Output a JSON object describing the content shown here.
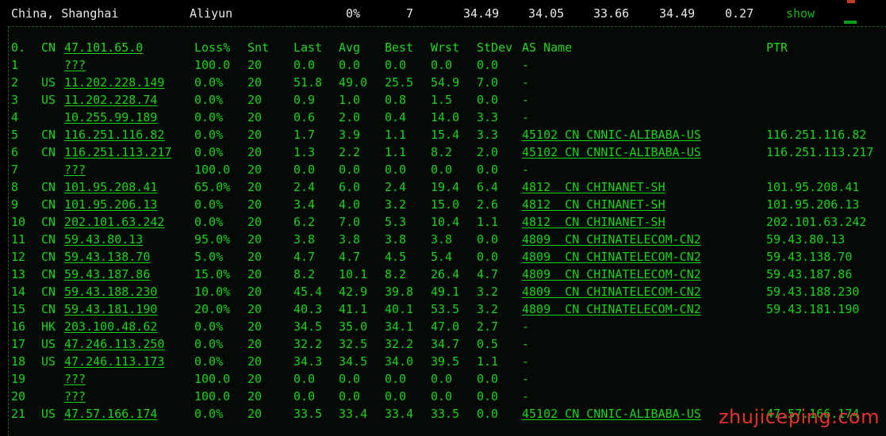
{
  "top_row": {
    "location": "China, Shanghai",
    "provider": "Aliyun",
    "loss": "0%",
    "snt": "7",
    "v1": "34.49",
    "v2": "34.05",
    "v3": "33.66",
    "v4": "34.49",
    "v5": "0.27",
    "show": "show"
  },
  "table": {
    "headers": {
      "hop": "0.",
      "cc": "CN",
      "host": "47.101.65.0",
      "loss": "Loss%",
      "snt": "Snt",
      "last": "Last",
      "avg": "Avg",
      "best": "Best",
      "wrst": "Wrst",
      "stdev": "StDev",
      "asname": "AS Name",
      "ptr": "PTR"
    },
    "rows": [
      {
        "hop": "1",
        "cc": "",
        "host": "???",
        "loss": "100.0",
        "snt": "20",
        "last": "0.0",
        "avg": "0.0",
        "best": "0.0",
        "wrst": "0.0",
        "stdev": "0.0",
        "asname": "-",
        "ptr": ""
      },
      {
        "hop": "2",
        "cc": "US",
        "host": "11.202.228.149",
        "loss": "0.0%",
        "snt": "20",
        "last": "51.8",
        "avg": "49.0",
        "best": "25.5",
        "wrst": "54.9",
        "stdev": "7.0",
        "asname": "-",
        "ptr": ""
      },
      {
        "hop": "3",
        "cc": "US",
        "host": "11.202.228.74",
        "loss": "0.0%",
        "snt": "20",
        "last": "0.9",
        "avg": "1.0",
        "best": "0.8",
        "wrst": "1.5",
        "stdev": "0.0",
        "asname": "-",
        "ptr": ""
      },
      {
        "hop": "4",
        "cc": "",
        "host": "10.255.99.189",
        "loss": "0.0%",
        "snt": "20",
        "last": "0.6",
        "avg": "2.0",
        "best": "0.4",
        "wrst": "14.0",
        "stdev": "3.3",
        "asname": "-",
        "ptr": ""
      },
      {
        "hop": "5",
        "cc": "CN",
        "host": "116.251.116.82",
        "loss": "0.0%",
        "snt": "20",
        "last": "1.7",
        "avg": "3.9",
        "best": "1.1",
        "wrst": "15.4",
        "stdev": "3.3",
        "asname": "45102 CN CNNIC-ALIBABA-US",
        "ptr": "116.251.116.82"
      },
      {
        "hop": "6",
        "cc": "CN",
        "host": "116.251.113.217",
        "loss": "0.0%",
        "snt": "20",
        "last": "1.3",
        "avg": "2.2",
        "best": "1.1",
        "wrst": "8.2",
        "stdev": "2.0",
        "asname": "45102 CN CNNIC-ALIBABA-US",
        "ptr": "116.251.113.217"
      },
      {
        "hop": "7",
        "cc": "",
        "host": "???",
        "loss": "100.0",
        "snt": "20",
        "last": "0.0",
        "avg": "0.0",
        "best": "0.0",
        "wrst": "0.0",
        "stdev": "0.0",
        "asname": "-",
        "ptr": ""
      },
      {
        "hop": "8",
        "cc": "CN",
        "host": "101.95.208.41",
        "loss": "65.0%",
        "snt": "20",
        "last": "2.4",
        "avg": "6.0",
        "best": "2.4",
        "wrst": "19.4",
        "stdev": "6.4",
        "asname": "4812  CN CHINANET-SH",
        "ptr": "101.95.208.41"
      },
      {
        "hop": "9",
        "cc": "CN",
        "host": "101.95.206.13",
        "loss": "0.0%",
        "snt": "20",
        "last": "3.4",
        "avg": "4.0",
        "best": "3.2",
        "wrst": "15.0",
        "stdev": "2.6",
        "asname": "4812  CN CHINANET-SH",
        "ptr": "101.95.206.13"
      },
      {
        "hop": "10",
        "cc": "CN",
        "host": "202.101.63.242",
        "loss": "0.0%",
        "snt": "20",
        "last": "6.2",
        "avg": "7.0",
        "best": "5.3",
        "wrst": "10.4",
        "stdev": "1.1",
        "asname": "4812  CN CHINANET-SH",
        "ptr": "202.101.63.242"
      },
      {
        "hop": "11",
        "cc": "CN",
        "host": "59.43.80.13",
        "loss": "95.0%",
        "snt": "20",
        "last": "3.8",
        "avg": "3.8",
        "best": "3.8",
        "wrst": "3.8",
        "stdev": "0.0",
        "asname": "4809  CN CHINATELECOM-CN2",
        "ptr": "59.43.80.13"
      },
      {
        "hop": "12",
        "cc": "CN",
        "host": "59.43.138.70",
        "loss": "5.0%",
        "snt": "20",
        "last": "4.7",
        "avg": "4.7",
        "best": "4.5",
        "wrst": "5.4",
        "stdev": "0.0",
        "asname": "4809  CN CHINATELECOM-CN2",
        "ptr": "59.43.138.70"
      },
      {
        "hop": "13",
        "cc": "CN",
        "host": "59.43.187.86",
        "loss": "15.0%",
        "snt": "20",
        "last": "8.2",
        "avg": "10.1",
        "best": "8.2",
        "wrst": "26.4",
        "stdev": "4.7",
        "asname": "4809  CN CHINATELECOM-CN2",
        "ptr": "59.43.187.86"
      },
      {
        "hop": "14",
        "cc": "CN",
        "host": "59.43.188.230",
        "loss": "10.0%",
        "snt": "20",
        "last": "45.4",
        "avg": "42.9",
        "best": "39.8",
        "wrst": "49.1",
        "stdev": "3.2",
        "asname": "4809  CN CHINATELECOM-CN2",
        "ptr": "59.43.188.230"
      },
      {
        "hop": "15",
        "cc": "CN",
        "host": "59.43.181.190",
        "loss": "20.0%",
        "snt": "20",
        "last": "40.3",
        "avg": "41.1",
        "best": "40.1",
        "wrst": "53.5",
        "stdev": "3.2",
        "asname": "4809  CN CHINATELECOM-CN2",
        "ptr": "59.43.181.190"
      },
      {
        "hop": "16",
        "cc": "HK",
        "host": "203.100.48.62",
        "loss": "0.0%",
        "snt": "20",
        "last": "34.5",
        "avg": "35.0",
        "best": "34.1",
        "wrst": "47.0",
        "stdev": "2.7",
        "asname": "-",
        "ptr": ""
      },
      {
        "hop": "17",
        "cc": "US",
        "host": "47.246.113.250",
        "loss": "0.0%",
        "snt": "20",
        "last": "32.2",
        "avg": "32.5",
        "best": "32.2",
        "wrst": "34.7",
        "stdev": "0.5",
        "asname": "-",
        "ptr": ""
      },
      {
        "hop": "18",
        "cc": "US",
        "host": "47.246.113.173",
        "loss": "0.0%",
        "snt": "20",
        "last": "34.3",
        "avg": "34.5",
        "best": "34.0",
        "wrst": "39.5",
        "stdev": "1.1",
        "asname": "-",
        "ptr": ""
      },
      {
        "hop": "19",
        "cc": "",
        "host": "???",
        "loss": "100.0",
        "snt": "20",
        "last": "0.0",
        "avg": "0.0",
        "best": "0.0",
        "wrst": "0.0",
        "stdev": "0.0",
        "asname": "-",
        "ptr": ""
      },
      {
        "hop": "20",
        "cc": "",
        "host": "???",
        "loss": "100.0",
        "snt": "20",
        "last": "0.0",
        "avg": "0.0",
        "best": "0.0",
        "wrst": "0.0",
        "stdev": "0.0",
        "asname": "-",
        "ptr": ""
      },
      {
        "hop": "21",
        "cc": "US",
        "host": "47.57.166.174",
        "loss": "0.0%",
        "snt": "20",
        "last": "33.5",
        "avg": "33.4",
        "best": "33.4",
        "wrst": "33.5",
        "stdev": "0.0",
        "asname": "45102 CN CNNIC-ALIBABA-US",
        "ptr": "47.57.166.174"
      }
    ]
  },
  "watermark": "zhujiceping.com",
  "colors": {
    "text_green": "#1cd11c",
    "top_text": "#e8e8e8",
    "watermark": "#e3322e"
  }
}
